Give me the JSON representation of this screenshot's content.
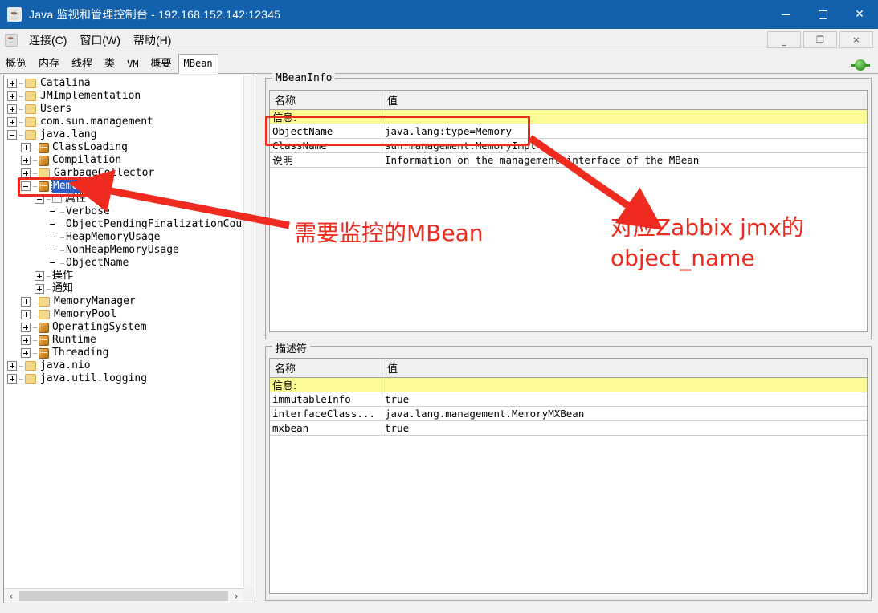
{
  "window": {
    "title": "Java 监视和管理控制台 - 192.168.152.142:12345",
    "icon": "java-cup-icon",
    "minimize_label": "最小化",
    "maximize_label": "最大化",
    "close_label": "关闭",
    "titlebar_color": "#1361ad"
  },
  "menubar": {
    "icon": "java-cup-icon",
    "items": [
      {
        "label": "连接(C)",
        "mnemonic": "C"
      },
      {
        "label": "窗口(W)",
        "mnemonic": "W"
      },
      {
        "label": "帮助(H)",
        "mnemonic": "H"
      }
    ],
    "mdi_buttons": [
      {
        "name": "mdi-minimize",
        "glyph": "_"
      },
      {
        "name": "mdi-restore",
        "glyph": "❐"
      },
      {
        "name": "mdi-close",
        "glyph": "×"
      }
    ]
  },
  "tabs": {
    "items": [
      {
        "label": "概览",
        "mono": false,
        "active": false
      },
      {
        "label": "内存",
        "mono": false,
        "active": false
      },
      {
        "label": "线程",
        "mono": false,
        "active": false
      },
      {
        "label": "类",
        "mono": false,
        "active": false
      },
      {
        "label": "VM",
        "mono": true,
        "active": false
      },
      {
        "label": "概要",
        "mono": false,
        "active": false
      },
      {
        "label": "MBean",
        "mono": true,
        "active": true
      }
    ],
    "connection_indicator": "connected-plug-icon"
  },
  "tree": {
    "nodes": [
      {
        "label": "Catalina",
        "indent": 0,
        "toggle": "plus",
        "icon": "folder",
        "selected": false
      },
      {
        "label": "JMImplementation",
        "indent": 0,
        "toggle": "plus",
        "icon": "folder",
        "selected": false
      },
      {
        "label": "Users",
        "indent": 0,
        "toggle": "plus",
        "icon": "folder",
        "selected": false
      },
      {
        "label": "com.sun.management",
        "indent": 0,
        "toggle": "plus",
        "icon": "folder",
        "selected": false
      },
      {
        "label": "java.lang",
        "indent": 0,
        "toggle": "minus",
        "icon": "folder",
        "selected": false
      },
      {
        "label": "ClassLoading",
        "indent": 1,
        "toggle": "plus",
        "icon": "bean",
        "selected": false
      },
      {
        "label": "Compilation",
        "indent": 1,
        "toggle": "plus",
        "icon": "bean",
        "selected": false
      },
      {
        "label": "GarbageCollector",
        "indent": 1,
        "toggle": "plus",
        "icon": "folder",
        "selected": false
      },
      {
        "label": "Memory",
        "indent": 1,
        "toggle": "minus",
        "icon": "bean",
        "selected": true
      },
      {
        "label": "属性",
        "indent": 2,
        "toggle": "minus",
        "icon": "node",
        "selected": false,
        "cjk": true
      },
      {
        "label": "Verbose",
        "indent": 3,
        "toggle": "leaf",
        "icon": "none",
        "selected": false
      },
      {
        "label": "ObjectPendingFinalizationCount",
        "indent": 3,
        "toggle": "leaf",
        "icon": "none",
        "selected": false
      },
      {
        "label": "HeapMemoryUsage",
        "indent": 3,
        "toggle": "leaf",
        "icon": "none",
        "selected": false
      },
      {
        "label": "NonHeapMemoryUsage",
        "indent": 3,
        "toggle": "leaf",
        "icon": "none",
        "selected": false
      },
      {
        "label": "ObjectName",
        "indent": 3,
        "toggle": "leaf",
        "icon": "none",
        "selected": false
      },
      {
        "label": "操作",
        "indent": 2,
        "toggle": "plus",
        "icon": "none",
        "selected": false,
        "cjk": true
      },
      {
        "label": "通知",
        "indent": 2,
        "toggle": "plus",
        "icon": "none",
        "selected": false,
        "cjk": true
      },
      {
        "label": "MemoryManager",
        "indent": 1,
        "toggle": "plus",
        "icon": "folder",
        "selected": false
      },
      {
        "label": "MemoryPool",
        "indent": 1,
        "toggle": "plus",
        "icon": "folder",
        "selected": false
      },
      {
        "label": "OperatingSystem",
        "indent": 1,
        "toggle": "plus",
        "icon": "bean",
        "selected": false
      },
      {
        "label": "Runtime",
        "indent": 1,
        "toggle": "plus",
        "icon": "bean",
        "selected": false
      },
      {
        "label": "Threading",
        "indent": 1,
        "toggle": "plus",
        "icon": "bean",
        "selected": false
      },
      {
        "label": "java.nio",
        "indent": 0,
        "toggle": "plus",
        "icon": "folder",
        "selected": false
      },
      {
        "label": "java.util.logging",
        "indent": 0,
        "toggle": "plus",
        "icon": "folder",
        "selected": false
      }
    ],
    "hscroll": {
      "left_arrow": "‹",
      "right_arrow": "›"
    }
  },
  "mbeaninfo": {
    "group_label": "MBeanInfo",
    "columns": [
      "名称",
      "值"
    ],
    "rows": [
      {
        "name": "信息:",
        "value": "",
        "highlight": true,
        "cjk": true
      },
      {
        "name": "ObjectName",
        "value": "java.lang:type=Memory",
        "highlight": false,
        "cjk": false
      },
      {
        "name": "ClassName",
        "value": "sun.management.MemoryImpl",
        "highlight": false,
        "cjk": false
      },
      {
        "name": "说明",
        "value": "Information on the management interface of the MBean",
        "highlight": false,
        "cjk": true
      }
    ]
  },
  "descriptor": {
    "group_label": "描述符",
    "columns": [
      "名称",
      "值"
    ],
    "rows": [
      {
        "name": "信息:",
        "value": "",
        "highlight": true,
        "cjk": true
      },
      {
        "name": "immutableInfo",
        "value": "true",
        "highlight": false,
        "cjk": false
      },
      {
        "name": "interfaceClass...",
        "value": "java.lang.management.MemoryMXBean",
        "highlight": false,
        "cjk": false
      },
      {
        "name": "mxbean",
        "value": "true",
        "highlight": false,
        "cjk": false
      }
    ]
  },
  "annotations": {
    "color": "#ee2b1e",
    "notes": [
      {
        "name": "annotation-mbean-to-monitor",
        "text": "需要监控的MBean"
      },
      {
        "name": "annotation-zabbix-object-name",
        "text": "对应Zabbix jmx的\nobject_name"
      }
    ],
    "boxes": [
      {
        "name": "redbox-memory-node"
      },
      {
        "name": "redbox-objectname-row"
      }
    ]
  }
}
